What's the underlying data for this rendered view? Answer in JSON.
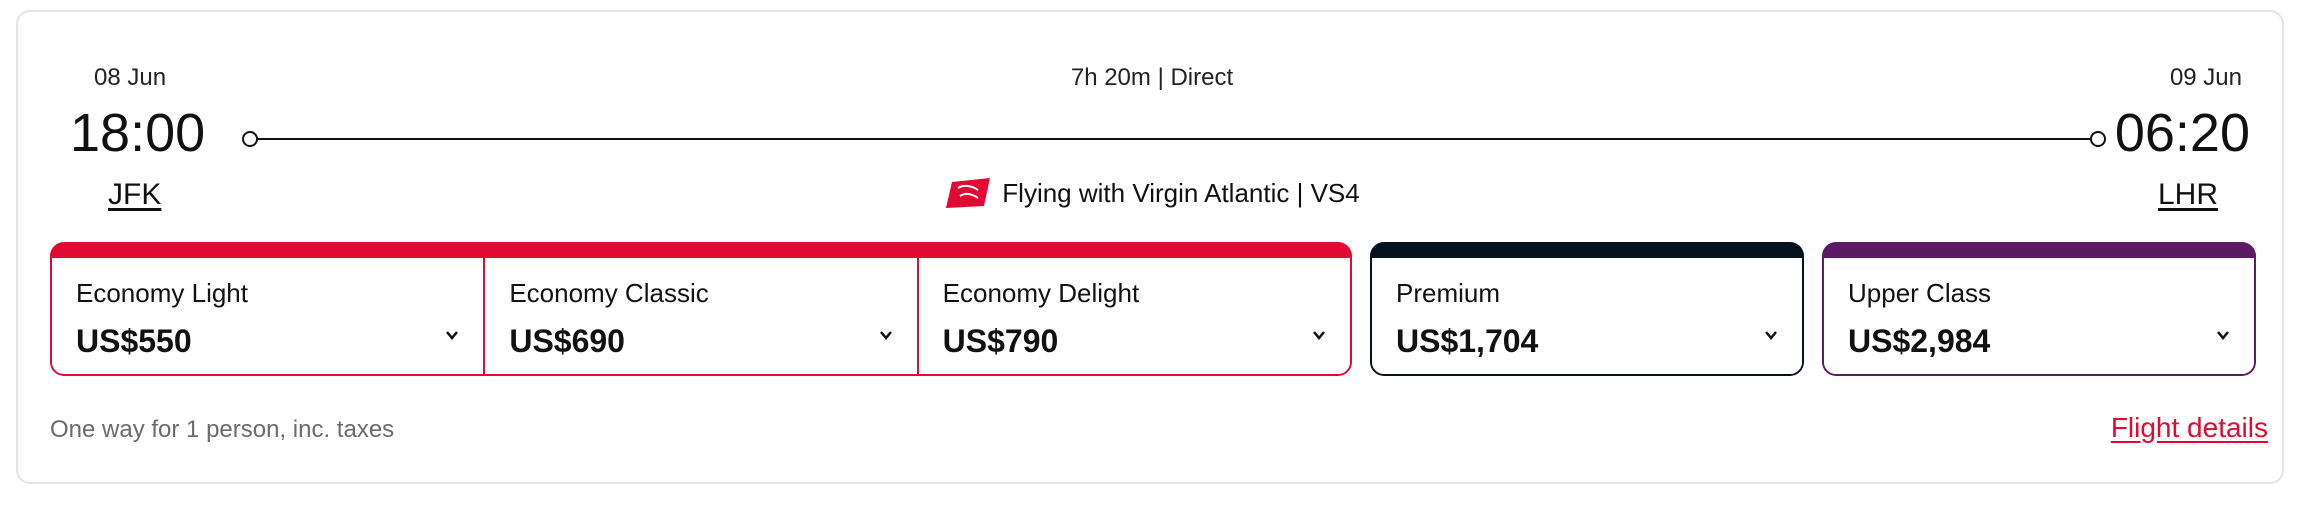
{
  "flight": {
    "departure": {
      "date": "08 Jun",
      "time": "18:00",
      "airport": "JFK"
    },
    "arrival": {
      "date": "09 Jun",
      "time": "06:20",
      "airport": "LHR"
    },
    "duration_label": "7h 20m  |  Direct",
    "airline_label": "Flying with Virgin Atlantic | VS4",
    "airline_logo_icon": "virgin-atlantic-logo-icon"
  },
  "fares": {
    "economy": {
      "accent": "#e10a32",
      "options": [
        {
          "name": "Economy Light",
          "price": "US$550"
        },
        {
          "name": "Economy Classic",
          "price": "US$690"
        },
        {
          "name": "Economy Delight",
          "price": "US$790"
        }
      ]
    },
    "premium": {
      "accent": "#07121f",
      "name": "Premium",
      "price": "US$1,704"
    },
    "upper": {
      "accent": "#5b1a63",
      "name": "Upper Class",
      "price": "US$2,984"
    }
  },
  "footer": {
    "note": "One way for 1 person, inc. taxes",
    "details_link": "Flight details"
  },
  "icons": {
    "dropdown": "chevron-down-icon"
  }
}
